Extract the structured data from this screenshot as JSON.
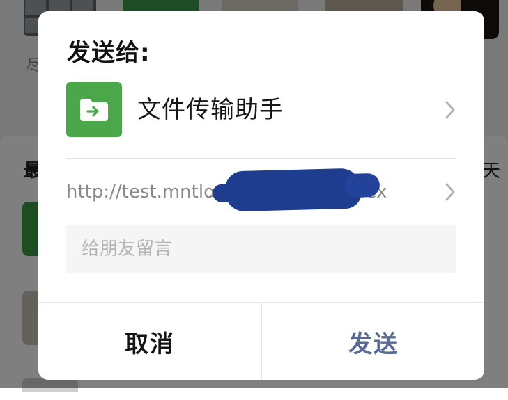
{
  "background": {
    "left_text": "尽",
    "section_title_left": "最",
    "section_title_right": "天"
  },
  "dialog": {
    "title": "发送给:",
    "recipient": {
      "name": "文件传输助手",
      "avatar_icon": "file-transfer-icon",
      "avatar_color": "#4aa74a"
    },
    "link": {
      "url_visible_prefix": "http://test.mntlo",
      "url_visible_suffix": "dex",
      "redaction_color": "#1e3d8f"
    },
    "message": {
      "placeholder": "给朋友留言",
      "value": ""
    },
    "actions": {
      "cancel_label": "取消",
      "send_label": "发送",
      "send_color": "#576b95"
    }
  }
}
